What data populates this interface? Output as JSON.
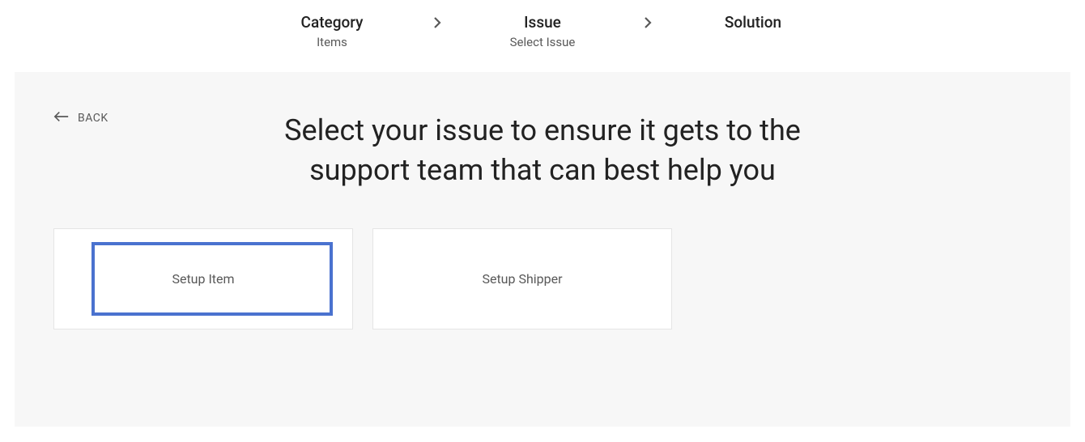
{
  "breadcrumb": {
    "steps": [
      {
        "title": "Category",
        "sub": "Items"
      },
      {
        "title": "Issue",
        "sub": "Select Issue"
      },
      {
        "title": "Solution",
        "sub": ""
      }
    ]
  },
  "back_label": "BACK",
  "heading": "Select your issue to ensure it gets to the support team that can best help you",
  "options": [
    {
      "label": "Setup Item",
      "highlighted": true
    },
    {
      "label": "Setup Shipper",
      "highlighted": false
    }
  ]
}
